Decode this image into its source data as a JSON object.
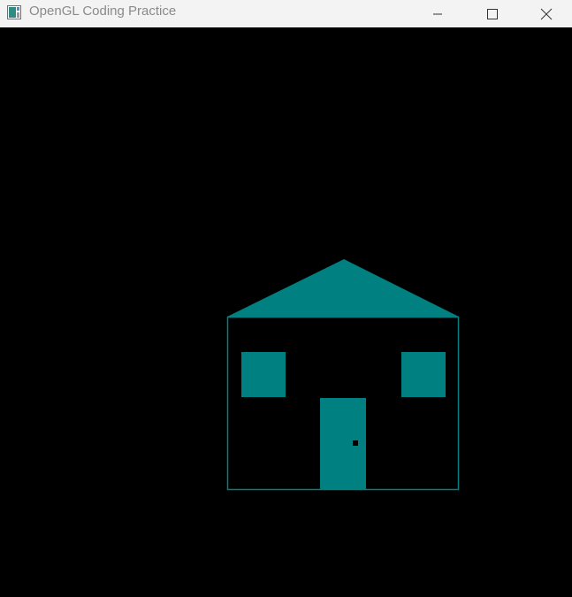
{
  "window": {
    "title": "OpenGL Coding Practice",
    "icon": "opengl-app-icon",
    "controls": {
      "minimize_icon": "minimize-icon",
      "maximize_icon": "maximize-icon",
      "close_icon": "close-icon"
    }
  },
  "scene": {
    "background_color": "#000000",
    "house_color": "#008080",
    "doorknob_color": "#000000"
  }
}
